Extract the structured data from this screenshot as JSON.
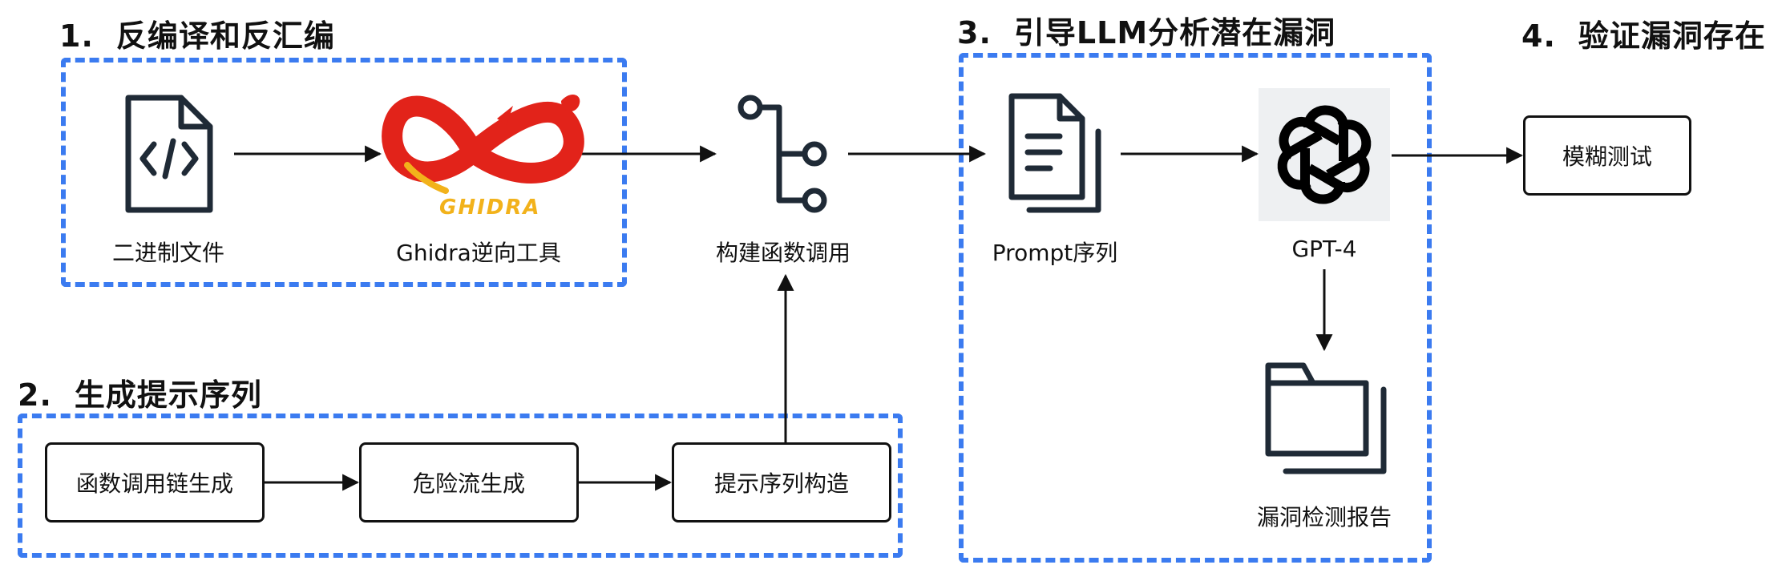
{
  "stages": [
    {
      "num": "1.",
      "title": "反编译和反汇编"
    },
    {
      "num": "2.",
      "title": "生成提示序列"
    },
    {
      "num": "3.",
      "title": "引导LLM分析潜在漏洞"
    },
    {
      "num": "4.",
      "title": "验证漏洞存在"
    }
  ],
  "nodes": {
    "binary_file": "二进制文件",
    "ghidra_tool": "Ghidra逆向工具",
    "ghidra_logo_text": "GHIDRA",
    "build_calls": "构建函数调用",
    "prompt_seq": "Prompt序列",
    "gpt4": "GPT-4",
    "vuln_report": "漏洞检测报告",
    "fuzz_test": "模糊测试",
    "call_chain": "函数调用链生成",
    "danger_flow": "危险流生成",
    "prompt_construct": "提示序列构造"
  },
  "colors": {
    "accent": "#3b7bf0",
    "ink": "#111111",
    "icon": "#1f2a36",
    "ghidra_red": "#e2231a",
    "ghidra_yellow": "#f2b21b"
  },
  "icons": {
    "binary_file": "code-file-icon",
    "ghidra": "ghidra-dragon-logo",
    "build_calls": "function-tree-icon",
    "prompt_seq": "documents-icon",
    "gpt4": "openai-logo-icon",
    "vuln_report": "folder-icon"
  }
}
